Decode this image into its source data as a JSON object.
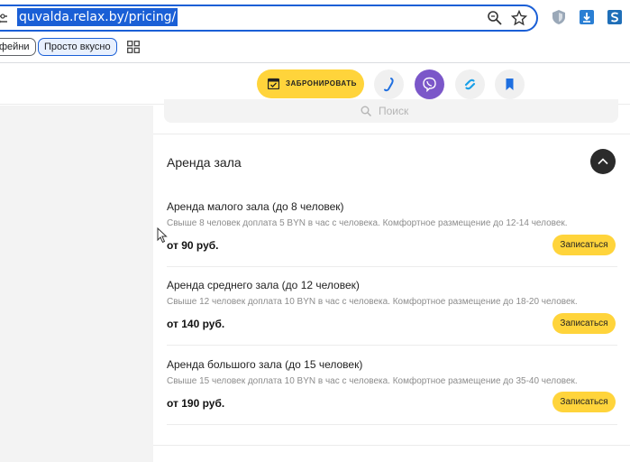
{
  "browser": {
    "url": "quvalda.relax.by/pricing/",
    "bookmarks": [
      {
        "label": "фейни"
      },
      {
        "label": "Просто вкусно"
      }
    ]
  },
  "header": {
    "book_label": "ЗАБРОНИРОВАТЬ",
    "icons": [
      "phone-icon",
      "viber-icon",
      "link-icon",
      "bookmark-icon"
    ],
    "accent": "#ffd43b"
  },
  "search": {
    "placeholder": "Поиск"
  },
  "section": {
    "title": "Аренда зала",
    "items": [
      {
        "title": "Аренда малого зала (до 8 человек)",
        "description": "Свыше 8 человек доплата 5 BYN в час с человека. Комфортное размещение до 12-14 человек.",
        "price": "от 90 руб.",
        "button": "Записаться"
      },
      {
        "title": "Аренда среднего зала (до 12 человек)",
        "description": "Свыше 12 человек доплата 10 BYN в час с человека. Комфортное размещение до 18-20 человек.",
        "price": "от 140 руб.",
        "button": "Записаться"
      },
      {
        "title": "Аренда большого зала (до 15 человек)",
        "description": "Свыше 15 человек доплата 10 BYN в час с человека. Комфортное размещение до 35-40 человек.",
        "price": "от 190 руб.",
        "button": "Записаться"
      }
    ]
  }
}
